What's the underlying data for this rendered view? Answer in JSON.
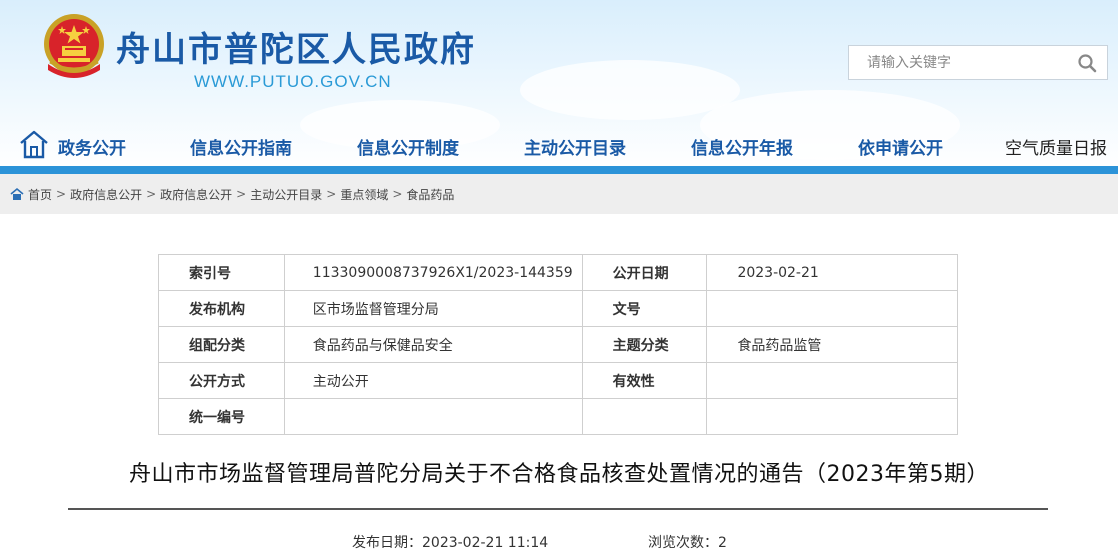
{
  "header": {
    "site_name": "舟山市普陀区人民政府",
    "site_url": "WWW.PUTUO.GOV.CN",
    "emblem_icon": "national-emblem-icon",
    "search_placeholder": "请输入关键字",
    "search_icon": "search-icon"
  },
  "nav": {
    "items": [
      "政务公开",
      "信息公开指南",
      "信息公开制度",
      "主动公开目录",
      "信息公开年报",
      "依申请公开",
      "空气质量日报"
    ],
    "home_icon": "home-icon"
  },
  "breadcrumb": {
    "items": [
      "首页",
      "政府信息公开",
      "政府信息公开",
      "主动公开目录",
      "重点领域",
      "食品药品"
    ]
  },
  "meta": {
    "index_label": "索引号",
    "index_value": "1133090008737926X1/2023-144359",
    "date_label": "公开日期",
    "date_value": "2023-02-21",
    "publisher_label": "发布机构",
    "publisher_value": "区市场监督管理分局",
    "docno_label": "文号",
    "docno_value": "",
    "category_label": "组配分类",
    "category_value": "食品药品与保健品安全",
    "topic_label": "主题分类",
    "topic_value": "食品药品监管",
    "method_label": "公开方式",
    "method_value": "主动公开",
    "validity_label": "有效性",
    "validity_value": "",
    "serial_label": "统一编号",
    "serial_value": ""
  },
  "doc": {
    "title": "舟山市市场监督管理局普陀分局关于不合格食品核查处置情况的通告（2023年第5期）",
    "publish_date": "发布日期：2023-02-21 11:14",
    "views": "浏览次数：2"
  },
  "colors": {
    "brand_blue": "#1a5aa6",
    "nav_bar": "#2c93d8",
    "url_blue": "#2a9ad6"
  }
}
